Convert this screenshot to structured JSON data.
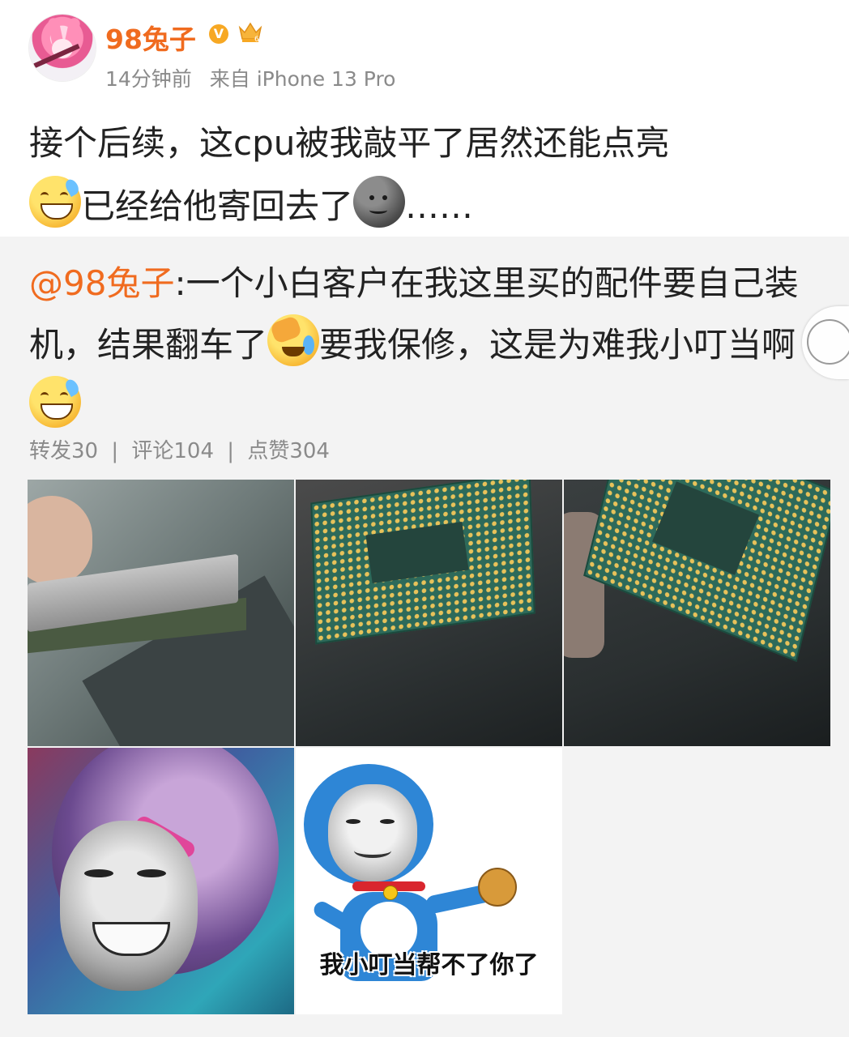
{
  "header": {
    "username": "98兔子",
    "vip_badge": "V",
    "crown_level": "6",
    "time": "14分钟前",
    "source": "来自 iPhone 13 Pro"
  },
  "post": {
    "line1": "接个后续，这cpu被我敲平了居然还能点亮",
    "line2_after_emoji": "已经给他寄回去了",
    "ellipsis": "……"
  },
  "repost": {
    "mention": "@98兔子",
    "text_part1": ":一个小白客户在我这里买的配件要自己装机，结果翻车了",
    "text_part2": "要我保修，这是为难我小叮当啊"
  },
  "stats": {
    "reposts": "转发30",
    "comments": "评论104",
    "likes": "点赞304",
    "separator": "|"
  },
  "images": {
    "caption5": "我小叮当帮不了你了"
  },
  "icons": [
    "grinning-sweat-emoji",
    "dark-moon-emoji",
    "facepalm-emoji",
    "verified-icon",
    "crown-icon",
    "scroll-indicator-icon"
  ],
  "colors": {
    "accent": "#f06b1f",
    "muted": "#8a8a8a",
    "repost_bg": "#f3f3f3"
  }
}
